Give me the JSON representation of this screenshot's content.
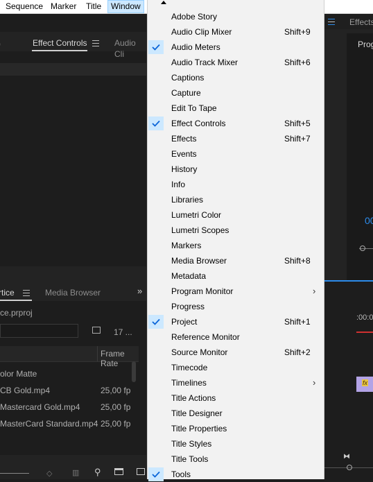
{
  "menubar": {
    "items": [
      "Sequence",
      "Marker",
      "Title",
      "Window"
    ]
  },
  "panels": {
    "top_tabs": [
      "Effect Controls",
      "Audio Cli",
      "Effects",
      "Prog"
    ],
    "project_tabs": [
      "rtice",
      "Media Browser"
    ],
    "project_file": "ce.prproj",
    "item_count": "17 ...",
    "column_frame_rate": "Frame Rate",
    "rows": [
      {
        "name": "olor Matte",
        "fps": ""
      },
      {
        "name": "CB Gold.mp4",
        "fps": "25,00 fp"
      },
      {
        "name": "Mastercard Gold.mp4",
        "fps": "25,00 fp"
      },
      {
        "name": "MasterCard Standard.mp4",
        "fps": "25,00 fp"
      }
    ],
    "timecode_partial": "00",
    "timeline_time": ":00:0",
    "fx_badge": "fx"
  },
  "menu": {
    "items": [
      {
        "label": "Adobe Story",
        "shortcut": "",
        "checked": false,
        "submenu": false
      },
      {
        "label": "Audio Clip Mixer",
        "shortcut": "Shift+9",
        "checked": false,
        "submenu": false
      },
      {
        "label": "Audio Meters",
        "shortcut": "",
        "checked": true,
        "submenu": false
      },
      {
        "label": "Audio Track Mixer",
        "shortcut": "Shift+6",
        "checked": false,
        "submenu": false
      },
      {
        "label": "Captions",
        "shortcut": "",
        "checked": false,
        "submenu": false
      },
      {
        "label": "Capture",
        "shortcut": "",
        "checked": false,
        "submenu": false
      },
      {
        "label": "Edit To Tape",
        "shortcut": "",
        "checked": false,
        "submenu": false
      },
      {
        "label": "Effect Controls",
        "shortcut": "Shift+5",
        "checked": true,
        "submenu": false
      },
      {
        "label": "Effects",
        "shortcut": "Shift+7",
        "checked": false,
        "submenu": false
      },
      {
        "label": "Events",
        "shortcut": "",
        "checked": false,
        "submenu": false
      },
      {
        "label": "History",
        "shortcut": "",
        "checked": false,
        "submenu": false
      },
      {
        "label": "Info",
        "shortcut": "",
        "checked": false,
        "submenu": false
      },
      {
        "label": "Libraries",
        "shortcut": "",
        "checked": false,
        "submenu": false
      },
      {
        "label": "Lumetri Color",
        "shortcut": "",
        "checked": false,
        "submenu": false
      },
      {
        "label": "Lumetri Scopes",
        "shortcut": "",
        "checked": false,
        "submenu": false
      },
      {
        "label": "Markers",
        "shortcut": "",
        "checked": false,
        "submenu": false
      },
      {
        "label": "Media Browser",
        "shortcut": "Shift+8",
        "checked": false,
        "submenu": false
      },
      {
        "label": "Metadata",
        "shortcut": "",
        "checked": false,
        "submenu": false
      },
      {
        "label": "Program Monitor",
        "shortcut": "",
        "checked": false,
        "submenu": true
      },
      {
        "label": "Progress",
        "shortcut": "",
        "checked": false,
        "submenu": false
      },
      {
        "label": "Project",
        "shortcut": "Shift+1",
        "checked": true,
        "submenu": false
      },
      {
        "label": "Reference Monitor",
        "shortcut": "",
        "checked": false,
        "submenu": false
      },
      {
        "label": "Source Monitor",
        "shortcut": "Shift+2",
        "checked": false,
        "submenu": false
      },
      {
        "label": "Timecode",
        "shortcut": "",
        "checked": false,
        "submenu": false
      },
      {
        "label": "Timelines",
        "shortcut": "",
        "checked": false,
        "submenu": true
      },
      {
        "label": "Title Actions",
        "shortcut": "",
        "checked": false,
        "submenu": false
      },
      {
        "label": "Title Designer",
        "shortcut": "",
        "checked": false,
        "submenu": false
      },
      {
        "label": "Title Properties",
        "shortcut": "",
        "checked": false,
        "submenu": false
      },
      {
        "label": "Title Styles",
        "shortcut": "",
        "checked": false,
        "submenu": false
      },
      {
        "label": "Title Tools",
        "shortcut": "",
        "checked": false,
        "submenu": false
      },
      {
        "label": "Tools",
        "shortcut": "",
        "checked": true,
        "submenu": false
      }
    ]
  },
  "colors": {
    "check_highlight": "#cce8ff",
    "check_mark": "#0a64d8",
    "accent_blue": "#2d8ceb",
    "fx_clip": "#b3a3e6"
  }
}
